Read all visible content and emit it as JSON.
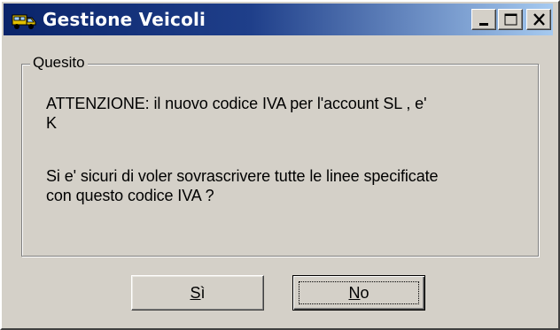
{
  "window": {
    "title": "Gestione Veicoli",
    "app_icon": "truck-icon",
    "controls": {
      "minimize_icon": "minimize-icon",
      "maximize_icon": "maximize-icon",
      "close_icon": "close-icon"
    }
  },
  "group": {
    "legend": "Quesito",
    "message_lines": [
      "ATTENZIONE: il nuovo codice IVA per l'account SL , e'",
      "K",
      "Si e' sicuri di voler sovrascrivere tutte le linee specificate",
      "con questo codice IVA ?"
    ]
  },
  "buttons": {
    "yes": {
      "label": "Sì",
      "mnemonic": "S",
      "rest": "ì"
    },
    "no": {
      "label": "No",
      "mnemonic": "N",
      "rest": "o",
      "default": true
    }
  },
  "colors": {
    "titlebar_start": "#0a246a",
    "titlebar_end": "#a6caf0",
    "face": "#d4d0c8"
  }
}
